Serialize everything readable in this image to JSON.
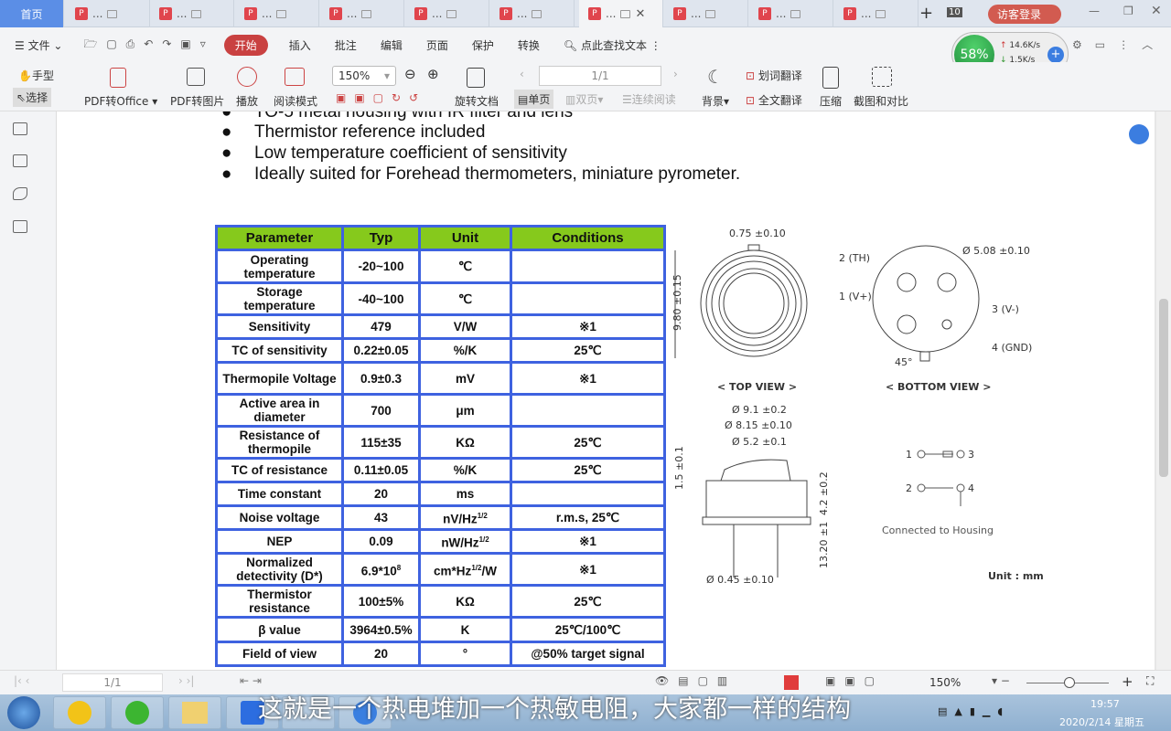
{
  "tabs": {
    "home": "首页",
    "doc_label": "...",
    "count": "10",
    "login": "访客登录"
  },
  "menu": {
    "file": "文件",
    "items": [
      "开始",
      "插入",
      "批注",
      "编辑",
      "页面",
      "保护",
      "转换"
    ],
    "search": "点此查找文本"
  },
  "network": {
    "percent": "58%",
    "up": "14.6K/s",
    "down": "1.5K/s"
  },
  "toolbar": {
    "hand": "手型",
    "select": "选择",
    "pdf_office": "PDF转Office",
    "pdf_image": "PDF转图片",
    "play": "播放",
    "read_mode": "阅读模式",
    "zoom": "150%",
    "rotate": "旋转文档",
    "single": "单页",
    "double": "双页",
    "continuous": "连续阅读",
    "page": "1/1",
    "background": "背景",
    "word_translate": "划词翻译",
    "full_translate": "全文翻译",
    "compress": "压缩",
    "compare": "截图和对比"
  },
  "bullets": [
    "TO-5 metal housing with IR filter and lens",
    "Thermistor reference included",
    "Low temperature coefficient of sensitivity",
    "Ideally suited for Forehead thermometers, miniature pyrometer."
  ],
  "table": {
    "headers": [
      "Parameter",
      "Typ",
      "Unit",
      "Conditions"
    ],
    "rows": [
      [
        "Operating temperature",
        "-20~100",
        "℃",
        ""
      ],
      [
        "Storage temperature",
        "-40~100",
        "℃",
        ""
      ],
      [
        "Sensitivity",
        "479",
        "V/W",
        "※1"
      ],
      [
        "TC of sensitivity",
        "0.22±0.05",
        "%/K",
        "25℃"
      ],
      [
        "Thermopile Voltage",
        "0.9±0.3",
        "mV",
        "※1"
      ],
      [
        "Active area in diameter",
        "700",
        "μm",
        ""
      ],
      [
        "Resistance of thermopile",
        "115±35",
        "KΩ",
        "25℃"
      ],
      [
        "TC of resistance",
        "0.11±0.05",
        "%/K",
        "25℃"
      ],
      [
        "Time constant",
        "20",
        "ms",
        ""
      ],
      [
        "Noise voltage",
        "43",
        "nV/Hz",
        "r.m.s, 25℃"
      ],
      [
        "NEP",
        "0.09",
        "nW/Hz",
        "※1"
      ],
      [
        "Normalized detectivity (D*)",
        "6.9*10",
        "cm*Hz",
        "※1"
      ],
      [
        "Thermistor resistance",
        "100±5%",
        "KΩ",
        "25℃"
      ],
      [
        "β value",
        "3964±0.5%",
        "K",
        "25℃/100℃"
      ],
      [
        "Field of view",
        "20",
        "°",
        "@50% target signal"
      ]
    ],
    "sup_half": "1/2",
    "sup_8": "8",
    "unit_w": "/W"
  },
  "diagram": {
    "d075": "0.75 ±0.10",
    "d980": "9.80 ±0.15",
    "top_view": "< TOP VIEW >",
    "bottom_view": "< BOTTOM VIEW >",
    "d508": "Ø 5.08 ±0.10",
    "p2": "2 (TH)",
    "p1": "1 (V+)",
    "p3": "3 (V-)",
    "p4": "4 (GND)",
    "angle": "45°",
    "d91": "Ø 9.1 ±0.2",
    "d815": "Ø 8.15 ±0.10",
    "d52": "Ø 5.2 ±0.1",
    "d15": "1.5 ±0.1",
    "d42": "4.2 ±0.2",
    "d1320": "13.20 ±1",
    "d045": "Ø 0.45 ±0.10",
    "c1": "1",
    "c3": "3",
    "c2": "2",
    "c4": "4",
    "housing": "Connected to Housing",
    "unit": "Unit : mm"
  },
  "status": {
    "page": "1/1",
    "zoom": "150%"
  },
  "taskbar": {
    "subtitle": "这就是一个热电堆加一个热敏电阻，大家都一样的结构",
    "time": "19:57",
    "date": "2020/2/14 星期五"
  }
}
